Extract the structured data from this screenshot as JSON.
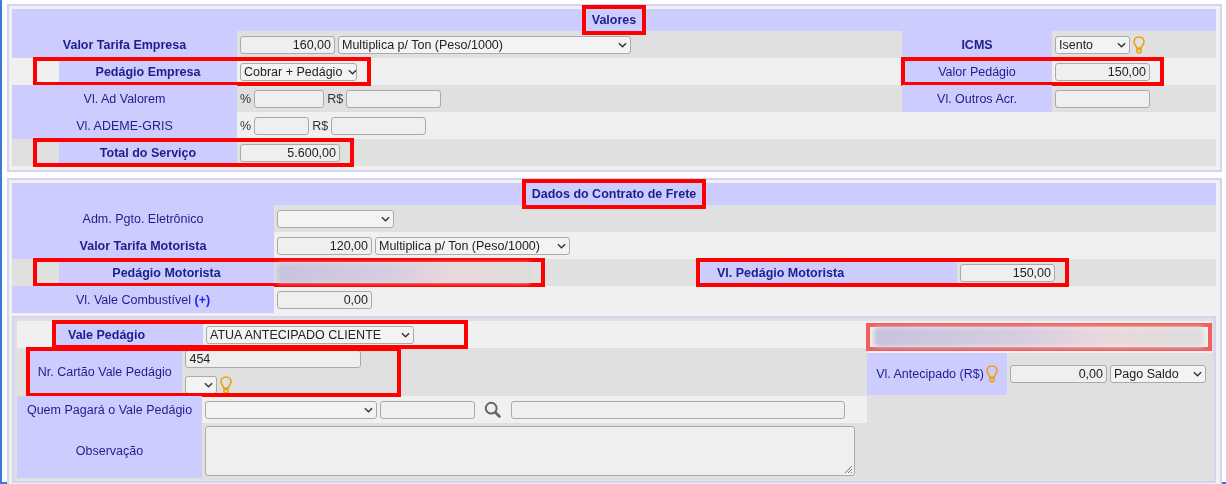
{
  "valores": {
    "title": "Valores",
    "title_highlighted": true,
    "rows": [
      {
        "label": "Valor Tarifa Empresa",
        "bold": true,
        "highlighted": false,
        "fields": [
          {
            "kind": "number",
            "value": "160,00"
          },
          {
            "kind": "select",
            "value": "Multiplica p/ Ton (Peso/1000)"
          }
        ],
        "right": {
          "label": "ICMS",
          "bold": true,
          "highlighted": false,
          "fields": [
            {
              "kind": "select",
              "value": "Isento"
            },
            {
              "kind": "bulb"
            }
          ]
        }
      },
      {
        "label": "Pedágio Empresa",
        "bold": true,
        "highlighted": true,
        "fields": [
          {
            "kind": "select",
            "value": "Cobrar + Pedágio"
          }
        ],
        "right": {
          "label": "Valor Pedágio",
          "bold": false,
          "highlighted": true,
          "fields": [
            {
              "kind": "number",
              "value": "150,00"
            }
          ]
        }
      },
      {
        "label": "Vl. Ad Valorem",
        "bold": false,
        "highlighted": false,
        "fields": [
          {
            "kind": "unit",
            "value": "%"
          },
          {
            "kind": "number"
          },
          {
            "kind": "unit",
            "value": "R$"
          },
          {
            "kind": "number"
          }
        ],
        "right": {
          "label": "Vl. Outros Acr.",
          "bold": false,
          "highlighted": false,
          "fields": [
            {
              "kind": "number"
            }
          ]
        }
      },
      {
        "label": "Vl. ADEME-GRIS",
        "bold": false,
        "highlighted": false,
        "fields": [
          {
            "kind": "unit",
            "value": "%"
          },
          {
            "kind": "number"
          },
          {
            "kind": "unit",
            "value": "R$"
          },
          {
            "kind": "number"
          }
        ]
      },
      {
        "label": "Total do Serviço",
        "bold": true,
        "highlighted": true,
        "fields": [
          {
            "kind": "number",
            "value": "5.600,00"
          }
        ]
      }
    ]
  },
  "contrato": {
    "title": "Dados do Contrato de Frete",
    "title_highlighted": true,
    "rows": [
      {
        "label": "Adm. Pgto. Eletrônico",
        "bold": false,
        "highlighted": false,
        "fields": [
          {
            "kind": "select"
          }
        ]
      },
      {
        "label": "Valor Tarifa Motorista",
        "bold": true,
        "highlighted": false,
        "fields": [
          {
            "kind": "number",
            "value": "120,00"
          },
          {
            "kind": "select",
            "value": "Multiplica p/ Ton (Peso/1000)"
          }
        ]
      },
      {
        "label": "Pedágio Motorista",
        "bold": true,
        "highlighted": true,
        "fields": [
          {
            "kind": "redacted"
          }
        ],
        "right": {
          "label": "Vl. Pedágio Motorista",
          "bold": true,
          "highlighted": true,
          "fields": [
            {
              "kind": "number",
              "value": "150,00"
            }
          ]
        }
      },
      {
        "label": "Vl. Vale Combustível **(+)**",
        "bold": false,
        "highlighted": false,
        "fields": [
          {
            "kind": "number",
            "value": "0,00"
          }
        ]
      }
    ],
    "vale": {
      "rows": [
        {
          "label": "Vale Pedágio",
          "bold": true,
          "highlighted": true,
          "fields": [
            {
              "kind": "select",
              "value": "ATUA ANTECIPADO CLIENTE"
            }
          ]
        },
        {
          "label": "Nr. Cartão Vale Pedágio",
          "bold": false,
          "highlighted": true,
          "fields": [
            {
              "kind": "text",
              "value": "454"
            },
            {
              "kind": "break"
            },
            {
              "kind": "select"
            },
            {
              "kind": "bulb"
            }
          ]
        },
        {
          "label": "Quem Pagará o Vale Pedágio",
          "bold": false,
          "highlighted": false,
          "fields": [
            {
              "kind": "select"
            },
            {
              "kind": "text"
            },
            {
              "kind": "search"
            },
            {
              "kind": "text"
            }
          ]
        },
        {
          "label": "Observação",
          "bold": false,
          "highlighted": false,
          "fields": [
            {
              "kind": "textarea"
            }
          ]
        }
      ],
      "side": {
        "top": {
          "kind": "redacted",
          "highlighted": true
        },
        "label": "Vl. Antecipado (R$)",
        "bold": false,
        "label_fields": [
          {
            "kind": "bulb"
          }
        ],
        "fields": [
          {
            "kind": "number",
            "value": "0,00"
          },
          {
            "kind": "select",
            "value": "Pago Saldo"
          }
        ]
      }
    }
  }
}
